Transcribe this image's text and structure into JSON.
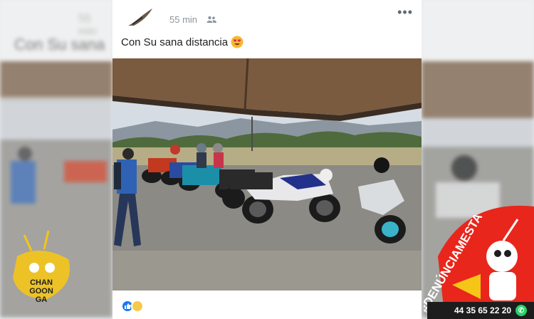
{
  "post": {
    "timestamp": "55 min",
    "audience_icon": "friends-icon",
    "more_icon": "more-options-icon",
    "caption": "Con Su sana distancia",
    "caption_emoji": "heart-eyes-emoji"
  },
  "background": {
    "left_time": "55 min",
    "left_caption": "Con Su sana"
  },
  "reactions": [
    "like",
    "haha"
  ],
  "watermarks": {
    "left_logo_text": "CHAN GOON GA",
    "right_hashtag": "#DENÚNCIAMESTA",
    "phone": "44 35 65 22 20"
  },
  "colors": {
    "facebook_blue": "#1877f2",
    "brand_red": "#e8261c",
    "brand_yellow": "#f5c518"
  }
}
